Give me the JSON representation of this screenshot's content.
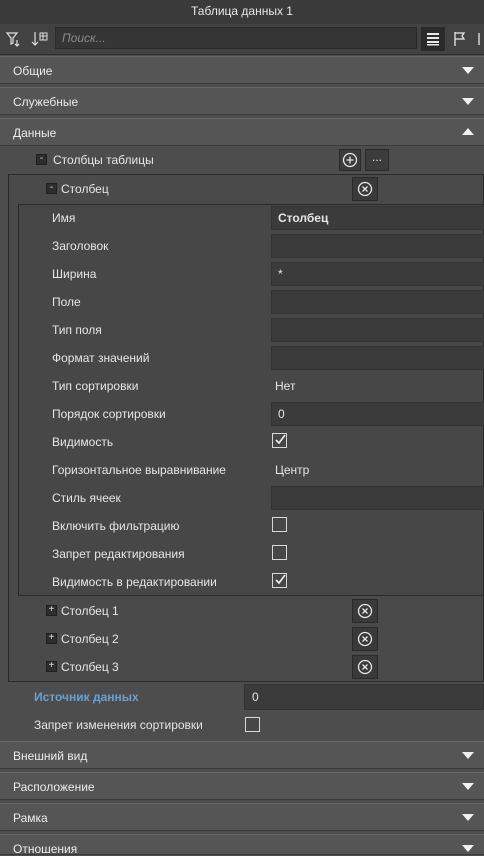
{
  "window": {
    "title": "Таблица данных 1"
  },
  "toolbar": {
    "search_placeholder": "Поиск..."
  },
  "sections": {
    "general": "Общие",
    "service": "Служебные",
    "data": "Данные",
    "appearance": "Внешний вид",
    "location": "Расположение",
    "frame": "Рамка",
    "relations": "Отношения"
  },
  "table_columns": {
    "label": "Столбцы таблицы",
    "expand_symbol": "-",
    "more_label": "...",
    "column_expanded": {
      "label": "Столбец",
      "expand_symbol": "-",
      "props": {
        "name": {
          "label": "Имя",
          "value": "Столбец"
        },
        "header": {
          "label": "Заголовок",
          "value": ""
        },
        "width": {
          "label": "Ширина",
          "value": "*"
        },
        "field": {
          "label": "Поле",
          "value": ""
        },
        "field_type": {
          "label": "Тип поля",
          "value": ""
        },
        "value_format": {
          "label": "Формат значений",
          "value": ""
        },
        "sort_type": {
          "label": "Тип сортировки",
          "value": "Нет"
        },
        "sort_order": {
          "label": "Порядок сортировки",
          "value": "0"
        },
        "visibility": {
          "label": "Видимость",
          "checked": true
        },
        "halign": {
          "label": "Горизонтальное выравнивание",
          "value": "Центр"
        },
        "cell_style": {
          "label": "Стиль ячеек",
          "value": ""
        },
        "enable_filter": {
          "label": "Включить фильтрацию",
          "checked": false
        },
        "edit_forbid": {
          "label": "Запрет редактирования",
          "checked": false
        },
        "edit_visibility": {
          "label": "Видимость в редактировании",
          "checked": true
        }
      }
    },
    "collapsed_columns": [
      {
        "label": "Столбец 1",
        "expand_symbol": "+"
      },
      {
        "label": "Столбец 2",
        "expand_symbol": "+"
      },
      {
        "label": "Столбец 3",
        "expand_symbol": "+"
      }
    ]
  },
  "data_source": {
    "label": "Источник данных",
    "value": "0"
  },
  "sort_change_forbid": {
    "label": "Запрет изменения сортировки",
    "checked": false
  },
  "colors": {
    "background": "#4d4d4d",
    "accent_link": "#6a9fd4",
    "titlebar": "#3a3a3a"
  }
}
